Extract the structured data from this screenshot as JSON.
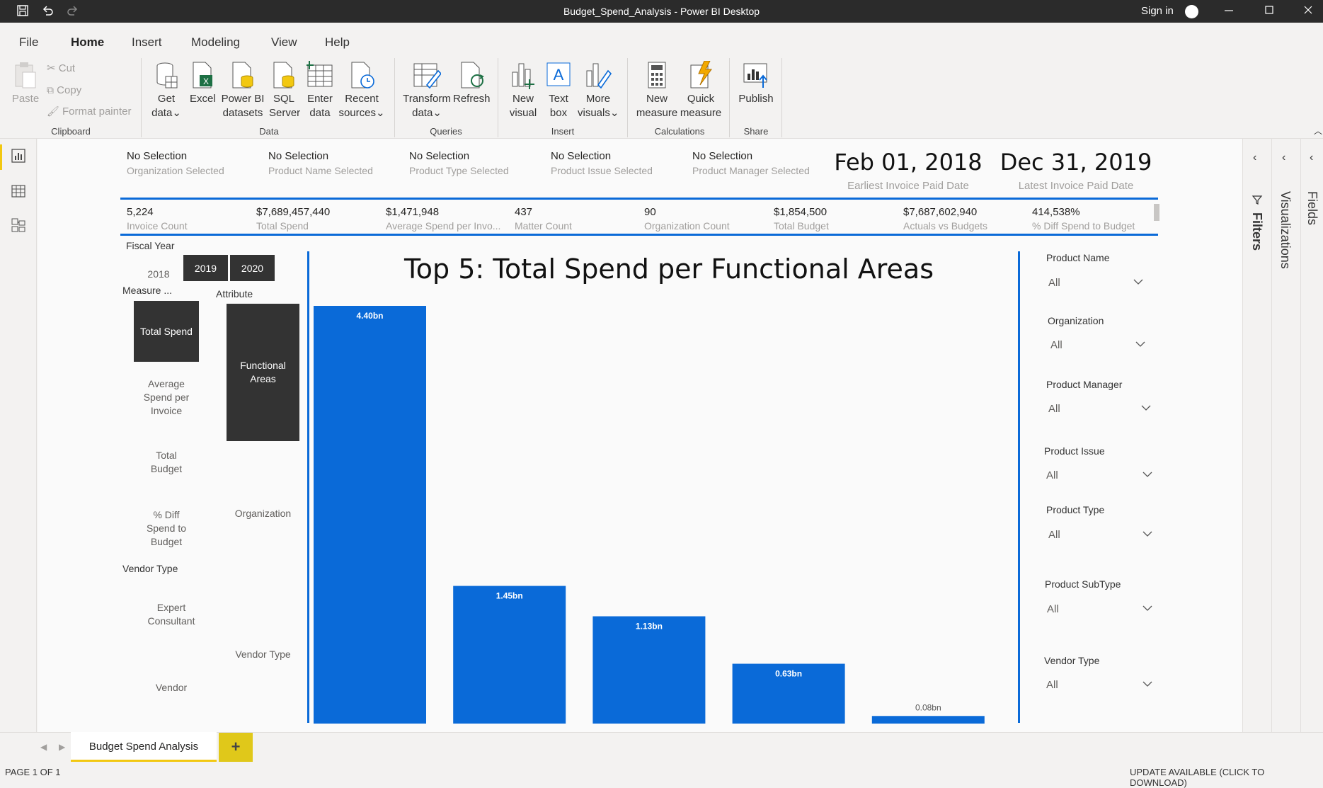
{
  "window": {
    "title": "Budget_Spend_Analysis - Power BI Desktop",
    "sign_in": "Sign in"
  },
  "menu": {
    "items": [
      "File",
      "Home",
      "Insert",
      "Modeling",
      "View",
      "Help"
    ],
    "active": "Home"
  },
  "ribbon": {
    "clipboard": {
      "paste": "Paste",
      "cut": "Cut",
      "copy": "Copy",
      "format_painter": "Format painter",
      "group": "Clipboard"
    },
    "data": {
      "get_data": [
        "Get",
        "data"
      ],
      "excel": "Excel",
      "power_bi": [
        "Power BI",
        "datasets"
      ],
      "sql": [
        "SQL",
        "Server"
      ],
      "enter": [
        "Enter",
        "data"
      ],
      "recent": [
        "Recent",
        "sources"
      ],
      "group": "Data"
    },
    "queries": {
      "transform": [
        "Transform",
        "data"
      ],
      "refresh": "Refresh",
      "group": "Queries"
    },
    "insert": {
      "new_visual": [
        "New",
        "visual"
      ],
      "text_box": [
        "Text",
        "box"
      ],
      "more_visuals": [
        "More",
        "visuals"
      ],
      "group": "Insert"
    },
    "calculations": {
      "new_measure": [
        "New",
        "measure"
      ],
      "quick_measure": [
        "Quick",
        "measure"
      ],
      "group": "Calculations"
    },
    "share": {
      "publish": "Publish",
      "group": "Share"
    }
  },
  "selections": [
    {
      "value": "No Selection",
      "label": "Organization Selected"
    },
    {
      "value": "No Selection",
      "label": "Product Name Selected"
    },
    {
      "value": "No Selection",
      "label": "Product Type Selected"
    },
    {
      "value": "No Selection",
      "label": "Product Issue Selected"
    },
    {
      "value": "No Selection",
      "label": "Product Manager Selected"
    }
  ],
  "dates": [
    {
      "value": "Feb 01, 2018",
      "label": "Earliest Invoice Paid Date"
    },
    {
      "value": "Dec 31, 2019",
      "label": "Latest Invoice Paid Date"
    }
  ],
  "kpis": [
    {
      "value": "5,224",
      "label": "Invoice Count"
    },
    {
      "value": "$7,689,457,440",
      "label": "Total Spend"
    },
    {
      "value": "$1,471,948",
      "label": "Average Spend per Invo..."
    },
    {
      "value": "437",
      "label": "Matter Count"
    },
    {
      "value": "90",
      "label": "Organization Count"
    },
    {
      "value": "$1,854,500",
      "label": "Total Budget"
    },
    {
      "value": "$7,687,602,940",
      "label": "Actuals vs Budgets"
    },
    {
      "value": "414,538%",
      "label": "% Diff Spend to Budget"
    }
  ],
  "slicers": {
    "fiscal_year": {
      "label": "Fiscal Year",
      "options": [
        "2018",
        "2019",
        "2020"
      ],
      "selected": [
        "2019",
        "2020"
      ]
    },
    "measure": {
      "label": "Measure ...",
      "selected": "Total Spend",
      "options": [
        [
          "Average",
          "Spend per",
          "Invoice"
        ],
        [
          "Total",
          "Budget"
        ],
        [
          "% Diff",
          "Spend to",
          "Budget"
        ]
      ]
    },
    "attribute": {
      "label": "Attribute",
      "selected": [
        "Functional",
        "Areas"
      ],
      "options": [
        "Organization",
        "Vendor Type"
      ]
    },
    "vendor_type": {
      "label": "Vendor Type",
      "options": [
        [
          "Expert",
          "Consultant"
        ],
        [
          "Vendor"
        ]
      ]
    }
  },
  "filters": [
    {
      "label": "Product Name",
      "value": "All"
    },
    {
      "label": "Organization",
      "value": "All"
    },
    {
      "label": "Product Manager",
      "value": "All"
    },
    {
      "label": "Product Issue",
      "value": "All"
    },
    {
      "label": "Product Type",
      "value": "All"
    },
    {
      "label": "Product SubType",
      "value": "All"
    },
    {
      "label": "Vendor Type",
      "value": "All"
    }
  ],
  "panes": {
    "filters": "Filters",
    "visualizations": "Visualizations",
    "fields": "Fields"
  },
  "chart_data": {
    "type": "bar",
    "title": "Top 5: Total Spend per Functional Areas",
    "categories": [],
    "values": [
      4.4,
      1.45,
      1.13,
      0.63,
      0.08
    ],
    "data_labels": [
      "4.40bn",
      "1.45bn",
      "1.13bn",
      "0.63bn",
      "0.08bn"
    ],
    "unit": "bn",
    "ylim": [
      0,
      4.4
    ],
    "grid": false,
    "color": "#0a6ad8"
  },
  "tabs": {
    "pages": [
      "Budget Spend Analysis"
    ],
    "add": "+"
  },
  "status": {
    "page": "PAGE 1 OF 1",
    "update": "UPDATE AVAILABLE (CLICK TO DOWNLOAD)"
  },
  "colors": {
    "accent": "#0a6ad8",
    "tab_yellow": "#f2c811",
    "dark_tile": "#333333"
  }
}
